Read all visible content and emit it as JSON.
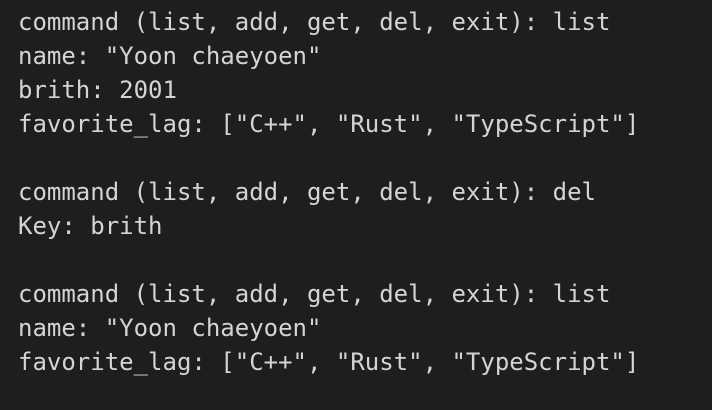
{
  "terminal": {
    "lines": [
      "command (list, add, get, del, exit): list",
      "name: \"Yoon chaeyoen\"",
      "brith: 2001",
      "favorite_lag: [\"C++\", \"Rust\", \"TypeScript\"]",
      "",
      "command (list, add, get, del, exit): del",
      "Key: brith",
      "",
      "command (list, add, get, del, exit): list",
      "name: \"Yoon chaeyoen\"",
      "favorite_lag: [\"C++\", \"Rust\", \"TypeScript\"]"
    ]
  }
}
